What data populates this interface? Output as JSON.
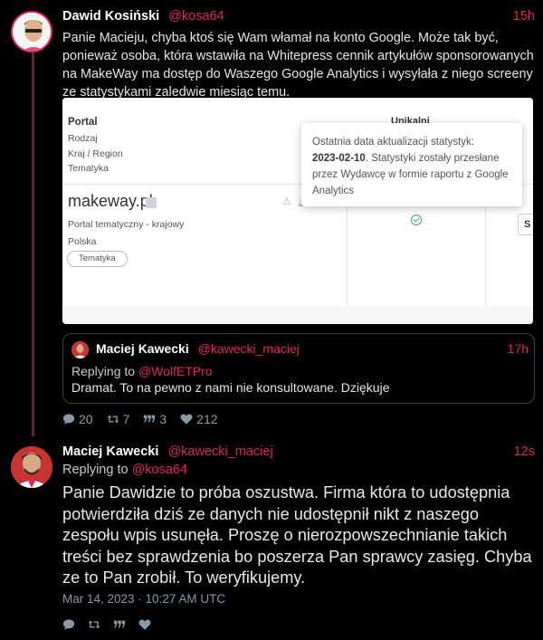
{
  "tweet1": {
    "author_name": "Dawid Kosiński",
    "handle": "@kosa64",
    "time": "15h",
    "text": "Panie Macieju, chyba ktoś się Wam włamał na konto Google. Może tak być, ponieważ osoba, która wstawiła na Whitepress cennik artykułów sponsorowanych na MakeWay ma dostęp do Waszego Google Analytics i wysyłała z niego screeny ze statystykami zaledwie miesiąc temu.",
    "image": {
      "header_portal": "Portal",
      "header_rodzaj": "Rodzaj",
      "header_kraj": "Kraj / Region",
      "header_tematyka": "Tematyka",
      "header_unikalni": "Unikalni",
      "site": "makeway.pl",
      "site_type": "Portal tematyczny - krajowy",
      "country": "Polska",
      "tag": "Tematyka",
      "button_letter": "S",
      "tooltip_line1": "Ostatnia data aktualizacji statystyk:",
      "tooltip_date": "2023-02-10",
      "tooltip_rest": ". Statystyki zostały przesłane przez Wydawcę w formie raportu z Google Analytics"
    },
    "quoted": {
      "author_name": "Maciej Kawecki",
      "handle": "@kawecki_maciej",
      "time": "17h",
      "replying_prefix": "Replying to",
      "replying_to": "@WolfETPro",
      "text": "Dramat. To na pewno z nami nie konsultowane. Dziękuje"
    },
    "stats": {
      "replies": "20",
      "retweets": "7",
      "quotes": "3",
      "likes": "212"
    }
  },
  "tweet2": {
    "author_name": "Maciej Kawecki",
    "handle": "@kawecki_maciej",
    "time": "12s",
    "replying_prefix": "Replying to",
    "replying_to": "@kosa64",
    "text": "Panie Dawidzie to próba oszustwa. Firma która to udostępnia potwierdziła dziś ze danych nie udostępnił nikt z naszego zespołu wpis usunęła. Proszę o nierozpowszechnianie takich treści bez sprawdzenia bo poszerza Pan sprawcy zasięg. Chyba ze to Pan zrobił. To weryfikujemy.",
    "date": "Mar 14, 2023 · 10:27 AM UTC"
  },
  "colors": {
    "accent": "#e0245e",
    "background": "#000000",
    "muted": "#8899a6",
    "thread_line": "#6b1e36"
  },
  "icons": [
    "reply-icon",
    "retweet-icon",
    "quote-icon",
    "heart-icon"
  ]
}
